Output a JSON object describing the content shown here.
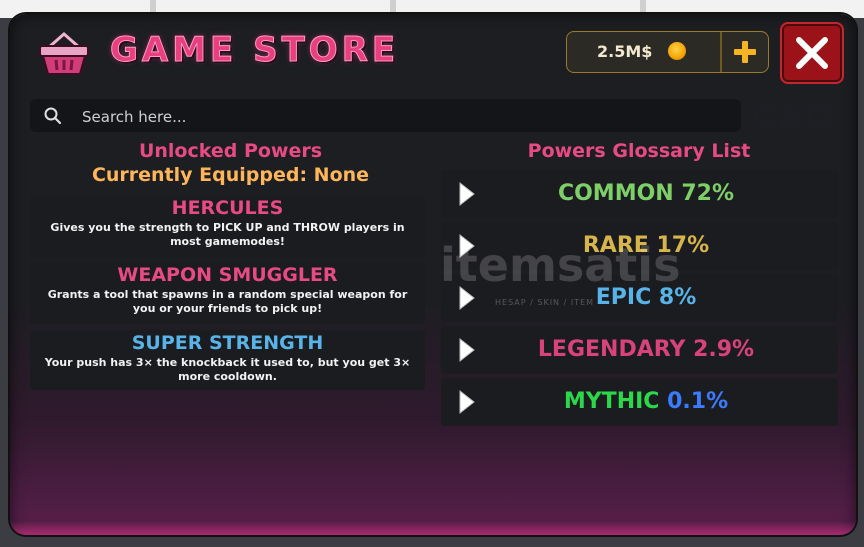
{
  "header": {
    "title": "GAME STORE",
    "money": "2.5M$"
  },
  "search": {
    "placeholder": "Search here..."
  },
  "unlocked": {
    "title": "Unlocked Powers",
    "equipped": "Currently Equipped: None",
    "powers": [
      {
        "name": "HERCULES",
        "color": "#e84a83",
        "description": "Gives you the strength to PICK UP and THROW players in most gamemodes!"
      },
      {
        "name": "WEAPON SMUGGLER",
        "color": "#e84a83",
        "description": "Grants a tool that spawns in a random special weapon for you or your friends to pick up!"
      },
      {
        "name": "SUPER STRENGTH",
        "color": "#58b3e8",
        "description": "Your push has 3× the knockback it used to, but you get 3× more cooldown."
      }
    ]
  },
  "glossary": {
    "title": "Powers Glossary List",
    "rarities": [
      {
        "label": "COMMON 72%",
        "color": "#7fcf69"
      },
      {
        "label": "RARE 17%",
        "color": "#d8b54a"
      },
      {
        "label": "EPIC 8%",
        "color": "#58b3e8"
      },
      {
        "label": "LEGENDARY 2.9%",
        "color": "#d9437b"
      },
      {
        "label": "MYTHIC",
        "pct": "0.1%",
        "color": "#2bd84a",
        "pct_color": "#3b7bff"
      }
    ]
  },
  "watermark": {
    "text": "itemsatis",
    "subtext": "HESAP / SKIN / ITEM"
  },
  "icons": [
    "basket-icon",
    "coin-icon",
    "plus-icon",
    "close-icon",
    "search-icon",
    "circle-icon",
    "triangle-icon",
    "square-icon",
    "play-icon"
  ]
}
